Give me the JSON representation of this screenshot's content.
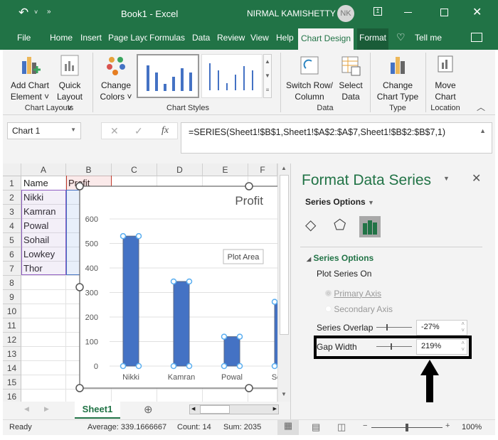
{
  "titlebar": {
    "title": "Book1  -  Excel",
    "user": "NIRMAL KAMISHETTY",
    "avatar": "NK"
  },
  "tabs": [
    "File",
    "Home",
    "Insert",
    "Page Layout",
    "Formulas",
    "Data",
    "Review",
    "View",
    "Help",
    "Chart Design",
    "Format"
  ],
  "tabs_display": [
    "File",
    "Home",
    "Insert",
    "Page Layo",
    "Formulas",
    "Data",
    "Review",
    "View",
    "Help",
    "Chart Design",
    "Format"
  ],
  "tell_me": "Tell me",
  "ribbon": {
    "add_chart_element": [
      "Add Chart",
      "Element ˅"
    ],
    "quick_layout": [
      "Quick",
      "Layout ˅"
    ],
    "change_colors": [
      "Change",
      "Colors ˅"
    ],
    "switch_row_column": [
      "Switch Row/",
      "Column"
    ],
    "select_data": [
      "Select",
      "Data"
    ],
    "change_chart_type": [
      "Change",
      "Chart Type"
    ],
    "move_chart": [
      "Move",
      "Chart"
    ],
    "groups": {
      "chart_layouts": "Chart Layouts",
      "chart_styles": "Chart Styles",
      "data": "Data",
      "type": "Type",
      "location": "Location"
    }
  },
  "formula_bar": {
    "name_box": "Chart 1",
    "formula": "=SERIES(Sheet1!$B$1,Sheet1!$A$2:$A$7,Sheet1!$B$2:$B$7,1)"
  },
  "sheet": {
    "columns": [
      "A",
      "B",
      "C",
      "D",
      "E",
      "F"
    ],
    "rows": [
      "1",
      "2",
      "3",
      "4",
      "5",
      "6",
      "7",
      "8",
      "9",
      "10",
      "11",
      "12",
      "13",
      "14",
      "15",
      "16"
    ],
    "cells_A": [
      "Name",
      "Nikki",
      "Kamran",
      "Powal",
      "Sohail",
      "Lowkey",
      "Thor"
    ],
    "cell_B1": "Profit",
    "sheet_tab": "Sheet1"
  },
  "chart_data": {
    "type": "bar",
    "title": "Profit",
    "categories": [
      "Nikki",
      "Kamran",
      "Powal",
      "Sohail"
    ],
    "values": [
      530,
      345,
      120,
      262
    ],
    "ylim": [
      0,
      600
    ],
    "yticks": [
      "0",
      "100",
      "200",
      "300",
      "400",
      "500",
      "600"
    ],
    "grid": true,
    "bar_color": "#4472c4",
    "tooltip": "Plot Area"
  },
  "pane": {
    "title": "Format Data Series",
    "series_options_dropdown": "Series Options",
    "section": "Series Options",
    "plot_series_on": "Plot Series On",
    "primary_axis": "Primary Axis",
    "secondary_axis": "Secondary Axis",
    "series_overlap_label": "Series Overlap",
    "series_overlap_value": "-27%",
    "gap_width_label": "Gap Width",
    "gap_width_value": "219%"
  },
  "status": {
    "ready": "Ready",
    "average": "Average: 339.1666667",
    "count": "Count: 14",
    "sum": "Sum: 2035",
    "zoom": "100%"
  },
  "accent": "#217346"
}
